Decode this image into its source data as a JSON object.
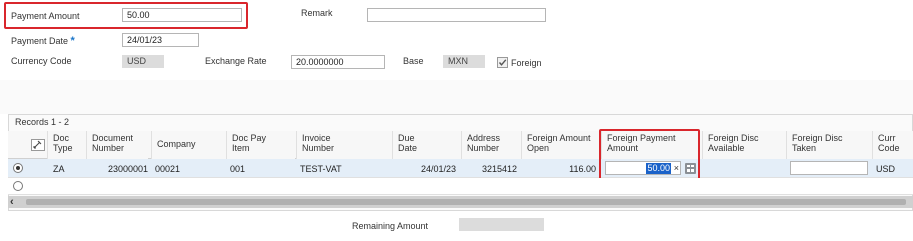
{
  "form": {
    "payment_amount_label": "Payment Amount",
    "payment_amount_value": "50.00",
    "remark_label": "Remark",
    "remark_value": "",
    "payment_date_label": "Payment Date",
    "payment_date_required": "*",
    "payment_date_value": "24/01/23",
    "currency_code_label": "Currency Code",
    "currency_code_value": "USD",
    "exchange_rate_label": "Exchange Rate",
    "exchange_rate_value": "20.0000000",
    "base_label": "Base",
    "base_value": "MXN",
    "foreign_label": "Foreign",
    "foreign_checked": true
  },
  "grid": {
    "records_label": "Records 1 - 2",
    "headers": {
      "doc_type": [
        "Doc",
        "Type"
      ],
      "document_number": [
        "Document",
        "Number"
      ],
      "company": [
        "Company"
      ],
      "doc_pay_item": [
        "Doc Pay",
        "Item"
      ],
      "invoice_number": [
        "Invoice",
        "Number"
      ],
      "due_date": [
        "Due",
        "Date"
      ],
      "address_number": [
        "Address",
        "Number"
      ],
      "foreign_amount_open": [
        "Foreign Amount",
        "Open"
      ],
      "foreign_payment_amount": [
        "Foreign Payment",
        "Amount"
      ],
      "foreign_disc_available": [
        "Foreign Disc",
        "Available"
      ],
      "foreign_disc_taken": [
        "Foreign Disc",
        "Taken"
      ],
      "curr_code": [
        "Curr",
        "Code"
      ]
    },
    "rows": [
      {
        "doc_type": "ZA",
        "document_number": "23000001",
        "company": "00021",
        "doc_pay_item": "001",
        "invoice_number": "TEST-VAT",
        "due_date": "24/01/23",
        "address_number": "3215412",
        "foreign_amount_open": "116.00",
        "foreign_payment_amount": "50.00",
        "foreign_disc_available": "",
        "foreign_disc_taken": "",
        "curr_code": "USD",
        "selected": true
      },
      {
        "doc_type": "",
        "document_number": "",
        "company": "",
        "doc_pay_item": "",
        "invoice_number": "",
        "due_date": "",
        "address_number": "",
        "foreign_amount_open": "",
        "foreign_payment_amount": "",
        "foreign_disc_available": "",
        "foreign_disc_taken": "",
        "curr_code": "",
        "selected": false
      }
    ],
    "clear_glyph": "×"
  },
  "footer": {
    "remaining_amount_label": "Remaining Amount",
    "remaining_amount_value": ""
  },
  "colors": {
    "highlight_red": "#d9262c",
    "required_blue": "#1a75c9",
    "selected_row": "#e4eef8",
    "selected_text_bg": "#1a62c9"
  }
}
